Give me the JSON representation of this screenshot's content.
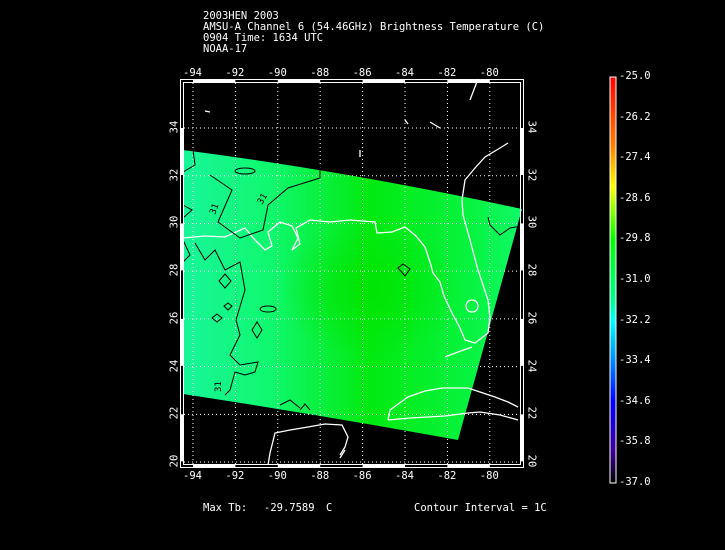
{
  "header": {
    "line1": "2003HEN 2003",
    "line2": "AMSU-A Channel 6 (54.46GHz) Brightness Temperature (C)",
    "line3": "0904 Time: 1634 UTC",
    "line4": "NOAA-17"
  },
  "map": {
    "lon_ticks": [
      "-94",
      "-92",
      "-90",
      "-88",
      "-86",
      "-84",
      "-82",
      "-80"
    ],
    "lat_ticks": [
      "34",
      "32",
      "30",
      "28",
      "26",
      "24",
      "22",
      "20"
    ],
    "contour_labels": [
      "31",
      "31",
      "31"
    ],
    "lon_range": [
      -94.5,
      -78.6
    ],
    "lat_range": [
      20,
      36
    ]
  },
  "colorbar": {
    "labels": [
      "-25.0",
      "-26.2",
      "-27.4",
      "-28.6",
      "-29.8",
      "-31.0",
      "-32.2",
      "-33.4",
      "-34.6",
      "-35.8",
      "-37.0"
    ],
    "colors": [
      "#ff0000",
      "#ff7000",
      "#ffe000",
      "#80ff00",
      "#00ff00",
      "#00ff90",
      "#00ffff",
      "#0080ff",
      "#0000ff",
      "#5000c0",
      "#200020"
    ]
  },
  "footer": {
    "max_label": "Max Tb:",
    "max_value": "-29.7589",
    "max_unit": "C",
    "contour_interval": "Contour Interval = 1C"
  }
}
